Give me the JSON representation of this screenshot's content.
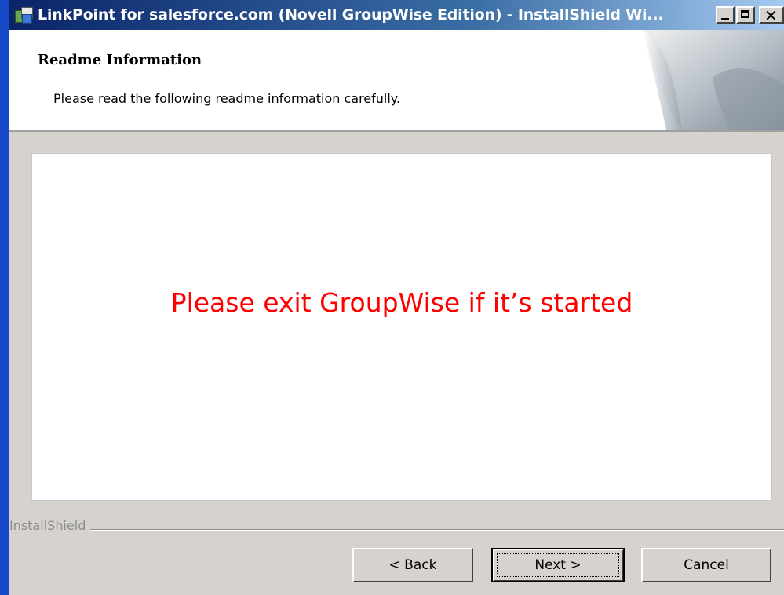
{
  "window": {
    "title": "LinkPoint for salesforce.com (Novell GroupWise Edition) - InstallShield Wi...",
    "icons": {
      "app": "installer-icon",
      "minimize": "minimize-icon",
      "maximize": "maximize-icon",
      "close": "close-icon"
    },
    "close_glyph": "✕"
  },
  "banner": {
    "heading": "Readme Information",
    "subtitle": "Please read the following readme information carefully."
  },
  "readme": {
    "message": "Please exit GroupWise if it’s started",
    "message_color": "#ff0000"
  },
  "footer": {
    "brand": "InstallShield"
  },
  "buttons": {
    "back": "< Back",
    "next": "Next >",
    "cancel": "Cancel"
  },
  "colors": {
    "desktop": "#1549c8",
    "dialog": "#d6d3ce",
    "titlebar_start": "#0a246a"
  }
}
